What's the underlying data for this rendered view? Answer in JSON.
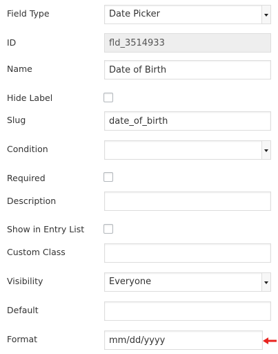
{
  "fields": {
    "field_type": {
      "label": "Field Type",
      "value": "Date Picker"
    },
    "id": {
      "label": "ID",
      "value": "fld_3514933"
    },
    "name": {
      "label": "Name",
      "value": "Date of Birth"
    },
    "hide_label": {
      "label": "Hide Label",
      "checked": false
    },
    "slug": {
      "label": "Slug",
      "value": "date_of_birth"
    },
    "condition": {
      "label": "Condition",
      "value": ""
    },
    "required": {
      "label": "Required",
      "checked": false
    },
    "description": {
      "label": "Description",
      "value": ""
    },
    "show_in_entry_list": {
      "label": "Show in Entry List",
      "checked": false
    },
    "custom_class": {
      "label": "Custom Class",
      "value": ""
    },
    "visibility": {
      "label": "Visibility",
      "value": "Everyone"
    },
    "default": {
      "label": "Default",
      "value": ""
    },
    "format": {
      "label": "Format",
      "value": "mm/dd/yyyy"
    }
  },
  "colors": {
    "annotation_arrow": "#e8231f",
    "input_border": "#dddddd",
    "readonly_bg": "#eeeeee",
    "label_text": "#333333"
  },
  "icons": {
    "annotation": "left-arrow-icon",
    "dropdown": "chevron-down-icon"
  }
}
